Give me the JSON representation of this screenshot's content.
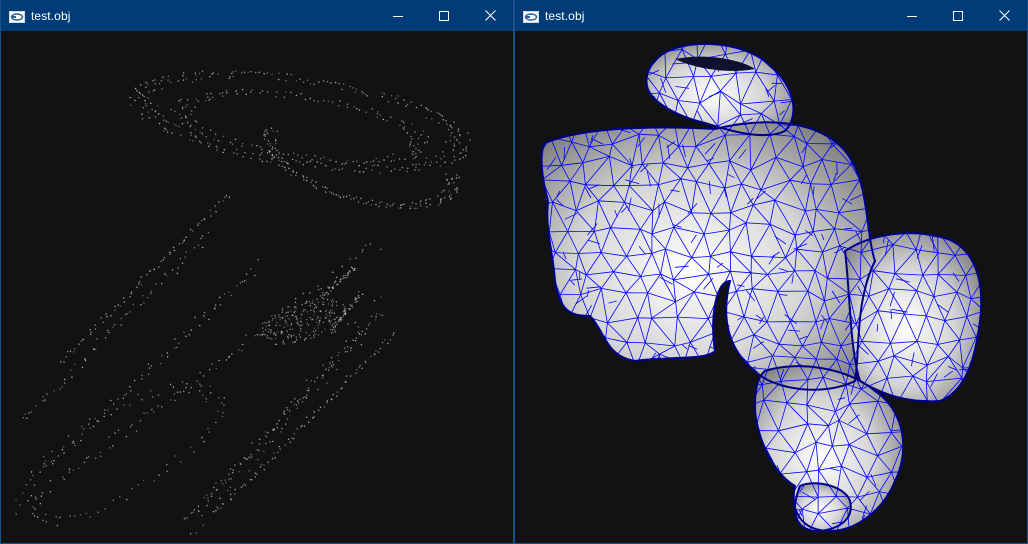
{
  "windows": [
    {
      "title": "test.obj",
      "view": "point-cloud"
    },
    {
      "title": "test.obj",
      "view": "shaded-wireframe"
    }
  ],
  "colors": {
    "titlebar": "#003c78",
    "background": "#121212",
    "points": "#bdbdbd",
    "wireframe": "#0000ff",
    "surface": "#e6e6e6"
  },
  "icons": {
    "app": "viewer-app-icon",
    "minimize": "minimize-icon",
    "maximize": "maximize-icon",
    "close": "close-icon"
  }
}
